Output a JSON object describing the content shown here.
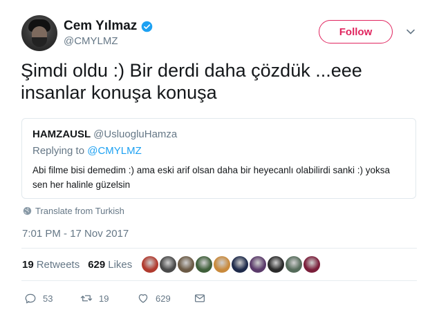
{
  "author": {
    "name": "Cem Yılmaz",
    "handle": "@CMYLMZ",
    "verified_icon": "verified-badge-icon"
  },
  "follow_label": "Follow",
  "tweet_text": "Şimdi oldu :) Bir derdi daha çözdük ...eee insanlar konuşa konuşa",
  "quote": {
    "name": "HAMZAUSL",
    "handle": "@UsluogluHamza",
    "replying_prefix": "Replying to ",
    "replying_handle": "@CMYLMZ",
    "text": "Abi filme bisi demedim :) ama eski arif olsan daha bir heyecanlı olabilirdi sanki :) yoksa sen her halinle güzelsin"
  },
  "translate_label": "Translate from Turkish",
  "timestamp": "7:01 PM - 17 Nov 2017",
  "stats": {
    "retweets_count": "19",
    "retweets_label": "Retweets",
    "likes_count": "629",
    "likes_label": "Likes"
  },
  "likers": [
    {
      "color": "#b03a2e"
    },
    {
      "color": "#4a4a4a"
    },
    {
      "color": "#6b5a45"
    },
    {
      "color": "#3f5f3a"
    },
    {
      "color": "#c98a3c"
    },
    {
      "color": "#1e2a4a"
    },
    {
      "color": "#5a3a6a"
    },
    {
      "color": "#2a2a2a"
    },
    {
      "color": "#556b5a"
    },
    {
      "color": "#7a1e3a"
    }
  ],
  "actions": {
    "replies": "53",
    "retweets": "19",
    "likes": "629"
  },
  "colors": {
    "accent_red": "#e0245e",
    "link_blue": "#1da1f2",
    "secondary_gray": "#657786"
  }
}
